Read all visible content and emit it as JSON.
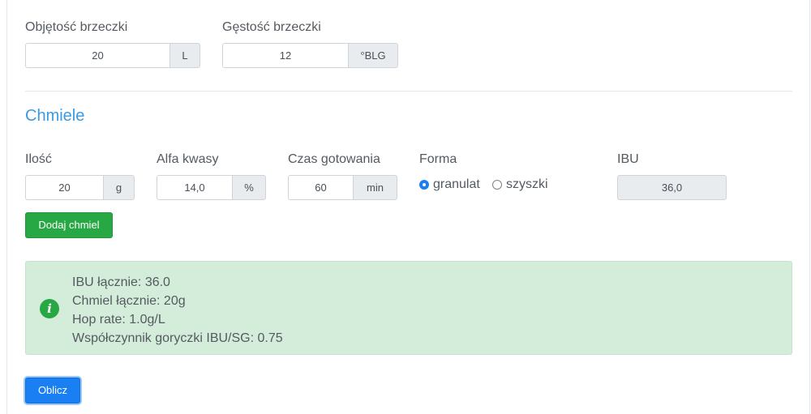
{
  "wort": {
    "volume_label": "Objętość brzeczki",
    "volume_value": "20",
    "volume_unit": "L",
    "gravity_label": "Gęstość brzeczki",
    "gravity_value": "12",
    "gravity_unit": "°BLG"
  },
  "hops": {
    "title": "Chmiele",
    "amount_label": "Ilość",
    "amount_value": "20",
    "amount_unit": "g",
    "alpha_label": "Alfa kwasy",
    "alpha_value": "14,0",
    "alpha_unit": "%",
    "boil_label": "Czas gotowania",
    "boil_value": "60",
    "boil_unit": "min",
    "form_label": "Forma",
    "form_options": [
      "granulat",
      "szyszki"
    ],
    "form_selected": "granulat",
    "ibu_label": "IBU",
    "ibu_value": "36,0",
    "add_button": "Dodaj chmiel"
  },
  "summary": {
    "icon": "info-icon",
    "lines": [
      "IBU łącznie: 36.0",
      "Chmiel łącznie: 20g",
      "Hop rate: 1.0g/L",
      "Współczynnik goryczki IBU/SG: 0.75"
    ]
  },
  "calculate_button": "Oblicz",
  "colors": {
    "accent": "#1a7ff2",
    "success": "#28a745",
    "alert_bg": "#d4edda",
    "title": "#3b9ae1"
  }
}
